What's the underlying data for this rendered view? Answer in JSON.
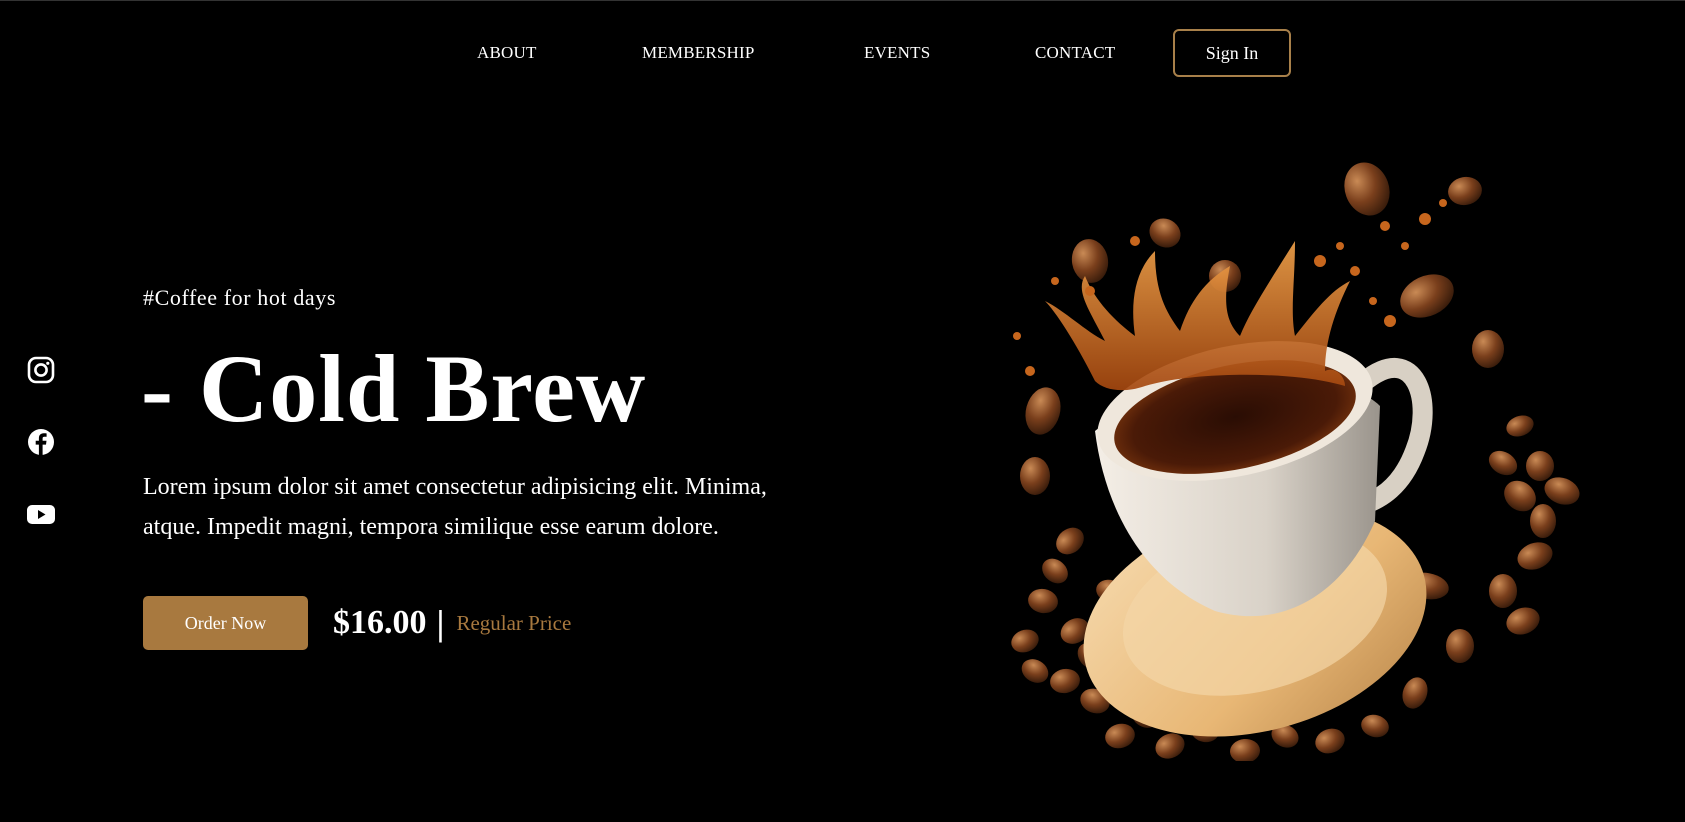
{
  "nav": {
    "items": [
      {
        "label": "ABOUT"
      },
      {
        "label": "MEMBERSHIP"
      },
      {
        "label": "EVENTS"
      },
      {
        "label": "CONTACT"
      }
    ],
    "signin_label": "Sign In"
  },
  "social": {
    "icons": [
      "instagram-icon",
      "facebook-icon",
      "youtube-icon"
    ]
  },
  "hero": {
    "hashtag": "#Coffee for hot days",
    "title": "- Cold Brew",
    "description": "Lorem ipsum dolor sit amet consectetur adipisicing elit. Minima, atque. Impedit magni, tempora similique esse earum dolore.",
    "order_label": "Order Now",
    "price": "$16.00",
    "price_separator": "|",
    "price_label": "Regular Price"
  },
  "colors": {
    "accent": "#a8793f",
    "border_accent": "#a8804a",
    "background": "#000000",
    "text": "#ffffff"
  }
}
